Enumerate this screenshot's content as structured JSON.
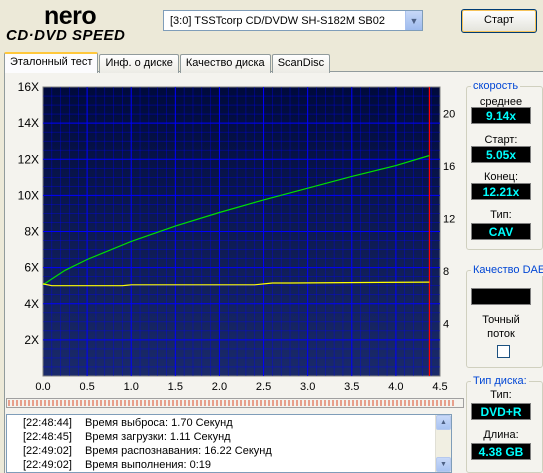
{
  "logo": {
    "brand": "nero",
    "product": "CD·DVD SPEED"
  },
  "drive": {
    "value": "[3:0]  TSSTcorp CD/DVDW SH-S182M SB02"
  },
  "start_label": "Старт",
  "tabs": [
    "Эталонный тест",
    "Инф. о диске",
    "Качество диска",
    "ScanDisc"
  ],
  "speed": {
    "title": "скорость",
    "avg_label": "среднее",
    "avg": "9.14x",
    "start_label": "Старт:",
    "start": "5.05x",
    "end_label": "Конец:",
    "end": "12.21x",
    "type_label": "Тип:",
    "type": "CAV"
  },
  "quality": {
    "title": "Качество DAE",
    "accurate_label": "Точный",
    "stream_label": "поток"
  },
  "disc": {
    "title": "Тип диска:",
    "type_label": "Тип:",
    "type": "DVD+R",
    "length_label": "Длина:",
    "length": "4.38 GB"
  },
  "progress": 0.98,
  "log": [
    {
      "time": "[22:48:44]",
      "msg": "Время выброса: 1.70 Секунд"
    },
    {
      "time": "[22:48:45]",
      "msg": "Время загрузки: 1.11 Секунд"
    },
    {
      "time": "[22:49:02]",
      "msg": "Время распознавания: 16.22 Секунд"
    },
    {
      "time": "[22:49:02]",
      "msg": "Время выполнения:  0:19"
    }
  ],
  "colors": {
    "plot_bg_top": "#000a3c",
    "plot_bg_bottom": "#1a2a6a",
    "grid": "#0000ff",
    "read_speed": "#00e000",
    "rpm": "#ffff00",
    "end_marker": "#ff0000"
  },
  "chart_data": {
    "type": "line",
    "xlim": [
      0,
      4.5
    ],
    "ylim": [
      0,
      16
    ],
    "y2lim": [
      0,
      22
    ],
    "x_ticks": [
      "0.0",
      "0.5",
      "1.0",
      "1.5",
      "2.0",
      "2.5",
      "3.0",
      "3.5",
      "4.0",
      "4.5"
    ],
    "y_ticks": [
      "2X",
      "4X",
      "6X",
      "8X",
      "10X",
      "12X",
      "14X",
      "16X"
    ],
    "y2_ticks": [
      "4",
      "8",
      "12",
      "16",
      "20"
    ],
    "end_marker_x": 4.38,
    "series": [
      {
        "color": "#00e000",
        "x": [
          0,
          0.25,
          0.5,
          1.0,
          1.5,
          2.0,
          2.5,
          3.0,
          3.5,
          4.0,
          4.38
        ],
        "y": [
          5.05,
          5.85,
          6.45,
          7.45,
          8.3,
          9.05,
          9.75,
          10.4,
          11.05,
          11.65,
          12.21
        ]
      },
      {
        "color": "#ffff00",
        "x": [
          0,
          0.1,
          0.9,
          1.0,
          2.4,
          2.6,
          2.8,
          4.38
        ],
        "y": [
          5.1,
          5.0,
          5.0,
          5.05,
          5.05,
          5.15,
          5.15,
          5.2
        ]
      }
    ]
  }
}
